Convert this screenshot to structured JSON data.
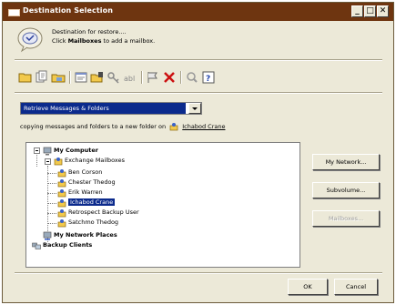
{
  "window": {
    "title": "Destination Selection",
    "minimize_glyph": "_",
    "maximize_glyph": "□",
    "close_glyph": "✕"
  },
  "header": {
    "line1": "Destination for restore....",
    "line2_prefix": "Click ",
    "line2_bold": "Mailboxes",
    "line2_suffix": " to add a mailbox."
  },
  "toolbar": {
    "icons": [
      "folder-open-icon",
      "pages-icon",
      "mailbox-icon",
      "properties-icon",
      "folder-edit-icon",
      "key-icon",
      "rename-icon",
      "flag-icon",
      "delete-x-icon",
      "help-search-icon",
      "question-icon"
    ]
  },
  "mode_select": {
    "value": "Retrieve Messages & Folders"
  },
  "copy_line": {
    "text": "copying messages and folders to a new folder on",
    "target": "Ichabod Crane"
  },
  "tree": {
    "root": "My Computer",
    "exchange": "Exchange Mailboxes",
    "mailboxes": [
      "Ben Corson",
      "Chester Thedog",
      "Erik Warren",
      "Ichabod Crane",
      "Retrospect Backup User",
      "Satchmo Thedog"
    ],
    "selected_index": 3,
    "network": "My Network Places",
    "clients": "Backup Clients"
  },
  "buttons": {
    "my_network": "My Network...",
    "subvolume": "Subvolume...",
    "mailboxes": "Mailboxes...",
    "ok": "OK",
    "cancel": "Cancel"
  },
  "colors": {
    "titlebar": "#6e3510",
    "selection": "#0b2a8c",
    "face": "#ece9d8"
  }
}
